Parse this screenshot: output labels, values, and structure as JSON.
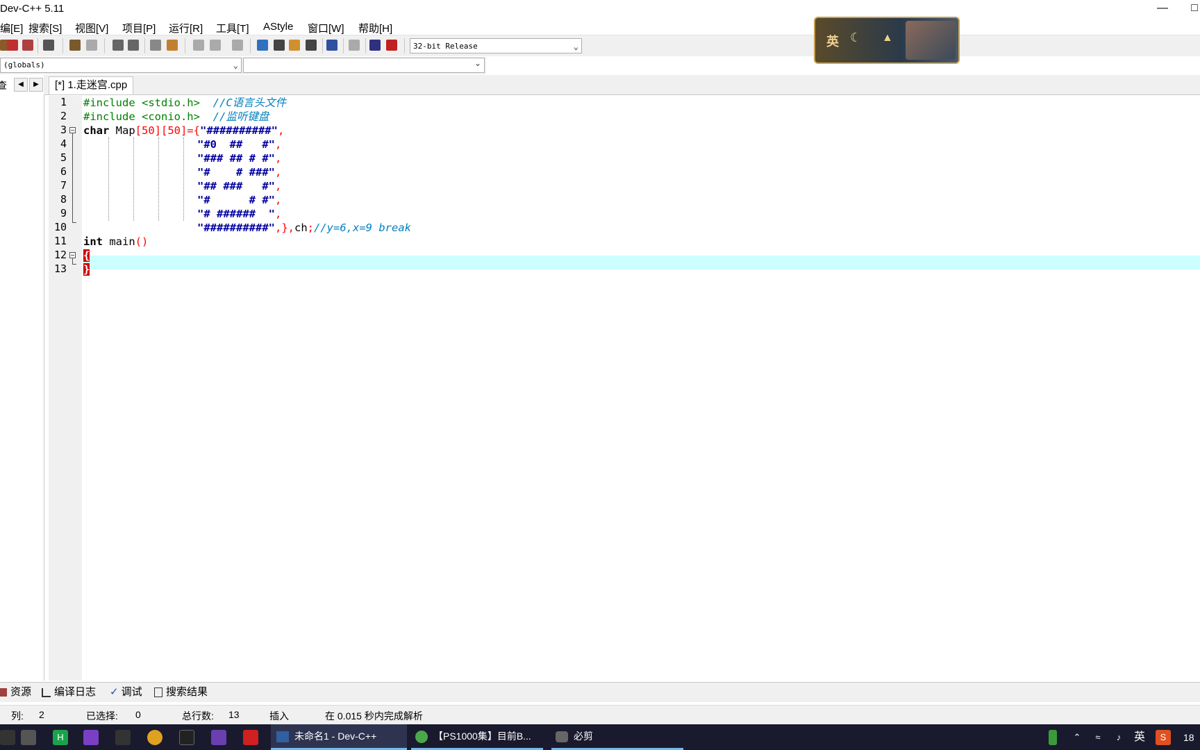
{
  "window": {
    "title": "Dev-C++ 5.11"
  },
  "menu": [
    "编[E]",
    "搜索[S]",
    "视图[V]",
    "项目[P]",
    "运行[R]",
    "工具[T]",
    "AStyle",
    "窗口[W]",
    "帮助[H]"
  ],
  "toolbar": {
    "compiler": "32-bit Release"
  },
  "scope": {
    "globals": "(globals)"
  },
  "left_panel": {
    "tab": "查看"
  },
  "file_tab": {
    "label": "[*] 1.走迷宫.cpp"
  },
  "editor": {
    "line_numbers": [
      "1",
      "2",
      "3",
      "4",
      "5",
      "6",
      "7",
      "8",
      "9",
      "10",
      "11",
      "12",
      "13"
    ],
    "code": {
      "l1_pre": "#include <stdio.h>",
      "l1_cm": "//C语言头文件",
      "l2_pre": "#include <conio.h>",
      "l2_cm": "//监听键盘",
      "l3_kw": "char",
      "l3_id": " Map",
      "l3_dims": "[50][50]={",
      "l3_str": "\"##########\"",
      "l4_str": "\"#0  ##   #\"",
      "l5_str": "\"### ## # #\"",
      "l6_str": "\"#    # ###\"",
      "l7_str": "\"## ###   #\"",
      "l8_str": "\"#      # #\"",
      "l9_str": "\"# ######  \"",
      "l10_str": "\"##########\"",
      "l10_tail_sym": ",},",
      "l10_tail_id": "ch",
      "l10_semi": ";",
      "l10_cm": "//y=6,x=9 break",
      "comma": ",",
      "l11_kw": "int",
      "l11_id": " main",
      "l11_paren": "()",
      "l12_brace": "{",
      "l13_brace": "}"
    }
  },
  "bottom_tabs": [
    "资源",
    "编译日志",
    "调试",
    "搜索结果"
  ],
  "status": {
    "col_label": "列:",
    "col_value": "2",
    "selected_label": "已选择:",
    "selected_value": "0",
    "lines_label": "总行数:",
    "lines_value": "13",
    "mode": "插入",
    "parse": "在 0.015 秒内完成解析"
  },
  "taskbar": {
    "windows": [
      "未命名1 - Dev-C++",
      "【PS1000集】目前B...",
      "必剪"
    ],
    "ime": "英",
    "clock": "18"
  },
  "overlay": {
    "label": "英"
  }
}
